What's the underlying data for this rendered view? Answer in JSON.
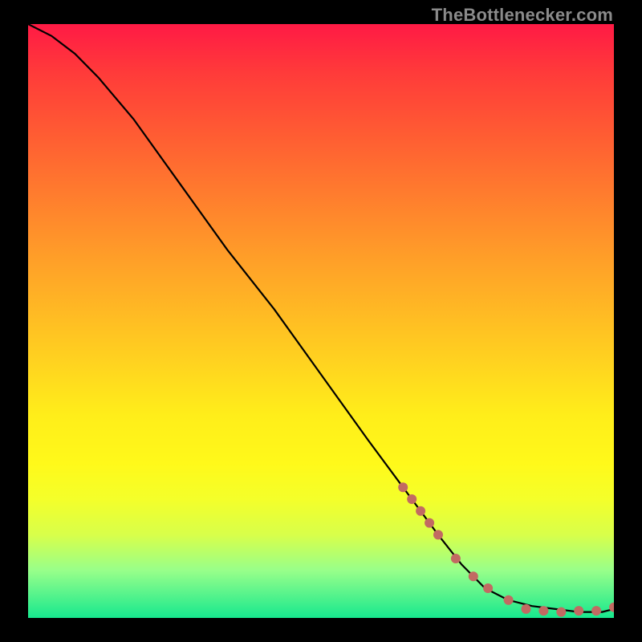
{
  "watermark": "TheBottlenecker.com",
  "chart_data": {
    "type": "line",
    "title": "",
    "xlabel": "",
    "ylabel": "",
    "xlim": [
      0,
      100
    ],
    "ylim": [
      0,
      100
    ],
    "legend": false,
    "grid": false,
    "series": [
      {
        "name": "curve",
        "x": [
          0,
          4,
          8,
          12,
          18,
          26,
          34,
          42,
          50,
          58,
          64,
          70,
          74,
          78,
          82,
          86,
          90,
          94,
          98,
          100
        ],
        "y": [
          100,
          98,
          95,
          91,
          84,
          73,
          62,
          52,
          41,
          30,
          22,
          14,
          9,
          5,
          3,
          2,
          1.5,
          1,
          1,
          1.5
        ]
      }
    ],
    "markers": [
      {
        "name": "highlight-points",
        "color": "#c26a62",
        "radius": 6,
        "x": [
          64,
          65.5,
          67,
          68.5,
          70,
          73,
          76,
          78.5,
          82,
          85,
          88,
          91,
          94,
          97,
          100
        ],
        "y": [
          22,
          20,
          18,
          16,
          14,
          10,
          7,
          5,
          3,
          1.5,
          1.2,
          1.0,
          1.2,
          1.2,
          1.8
        ]
      }
    ]
  }
}
